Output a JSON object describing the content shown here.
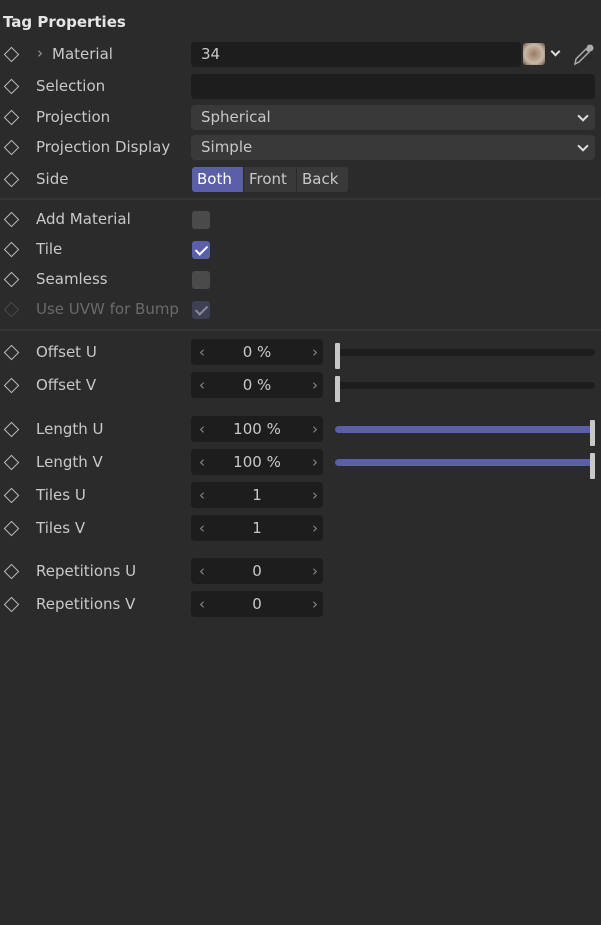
{
  "title": "Tag Properties",
  "material": {
    "label": "Material",
    "value": "34",
    "expand_icon": "chevron-right-icon"
  },
  "selection": {
    "label": "Selection",
    "value": ""
  },
  "projection": {
    "label": "Projection",
    "value": "Spherical"
  },
  "projection_display": {
    "label": "Projection Display",
    "value": "Simple"
  },
  "side": {
    "label": "Side",
    "options": [
      "Both",
      "Front",
      "Back"
    ],
    "selected": "Both"
  },
  "checkboxes": [
    {
      "label": "Add Material",
      "checked": false,
      "enabled": true
    },
    {
      "label": "Tile",
      "checked": true,
      "enabled": true
    },
    {
      "label": "Seamless",
      "checked": false,
      "enabled": true
    },
    {
      "label": "Use UVW for Bump",
      "checked": true,
      "enabled": false
    }
  ],
  "numeric": [
    {
      "label": "Offset U",
      "value": "0 %",
      "slider": 0
    },
    {
      "label": "Offset V",
      "value": "0 %",
      "slider": 0
    },
    {
      "label": "Length U",
      "value": "100 %",
      "slider": 100
    },
    {
      "label": "Length V",
      "value": "100 %",
      "slider": 100
    },
    {
      "label": "Tiles U",
      "value": "1"
    },
    {
      "label": "Tiles V",
      "value": "1"
    },
    {
      "label": "Repetitions U",
      "value": "0"
    },
    {
      "label": "Repetitions V",
      "value": "0"
    }
  ],
  "colors": {
    "accent": "#5a5fa8",
    "background": "#2b2b2b",
    "field": "#1d1d1d"
  }
}
